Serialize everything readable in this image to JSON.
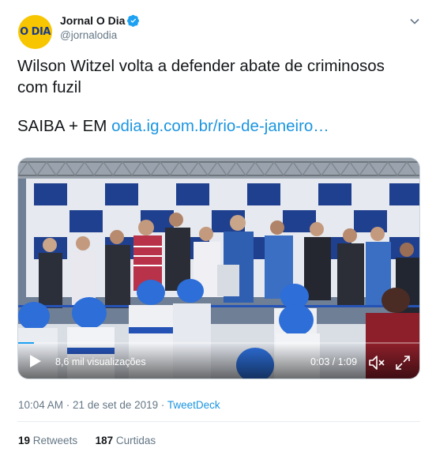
{
  "author": {
    "name": "Jornal O Dia",
    "handle": "@jornalodia",
    "avatar_text": "O DIA"
  },
  "tweet": {
    "line1": "Wilson Witzel volta a defender abate de criminosos",
    "line2": "com fuzil",
    "saiba_prefix": "SAIBA + EM ",
    "link_text": "odia.ig.com.br/rio-de-janeiro…"
  },
  "video": {
    "views": "8,6 mil visualizações",
    "time": "0:03 / 1:09",
    "progress": 0.04
  },
  "meta": {
    "time": "10:04 AM",
    "separator": " · ",
    "date": "21 de set de 2019",
    "app": "TweetDeck"
  },
  "stats": {
    "retweets_count": "19",
    "retweets_label": "Retweets",
    "likes_count": "187",
    "likes_label": "Curtidas"
  },
  "colors": {
    "link": "#1b95e0",
    "verified": "#1da1f2",
    "avatar_bg": "#f7c600",
    "text_secondary": "#657786"
  },
  "icons": [
    "verified-badge-icon",
    "chevron-down-icon",
    "play-icon",
    "mute-icon",
    "fullscreen-icon"
  ]
}
